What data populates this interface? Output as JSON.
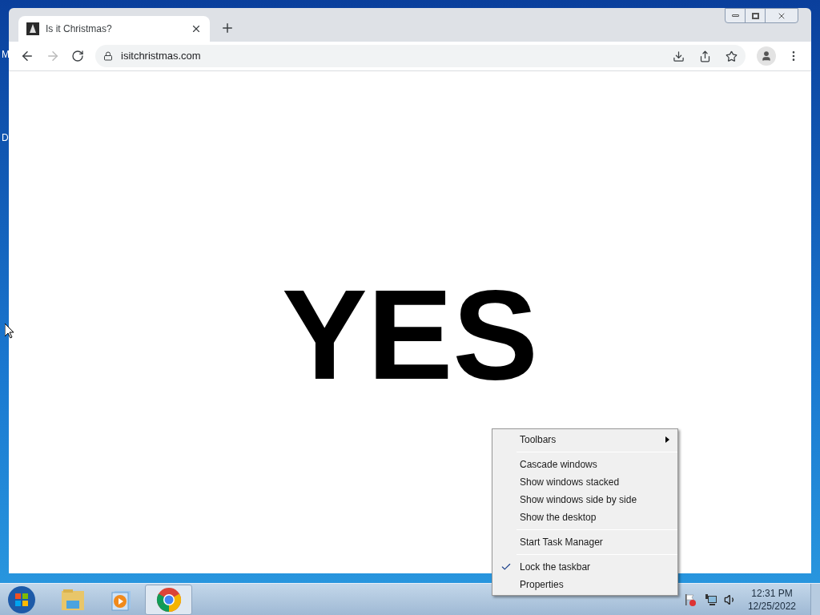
{
  "desktop_labels": [
    "M",
    "D"
  ],
  "browser": {
    "tab": {
      "title": "Is it Christmas?",
      "selected": true
    },
    "url": "isitchristmas.com",
    "back_disabled": false,
    "forward_disabled": true
  },
  "page": {
    "answer": "YES"
  },
  "context_menu": {
    "items": [
      {
        "kind": "submenu",
        "label": "Toolbars"
      },
      {
        "kind": "separator"
      },
      {
        "kind": "item",
        "label": "Cascade windows"
      },
      {
        "kind": "item",
        "label": "Show windows stacked"
      },
      {
        "kind": "item",
        "label": "Show windows side by side"
      },
      {
        "kind": "item",
        "label": "Show the desktop"
      },
      {
        "kind": "separator"
      },
      {
        "kind": "item",
        "label": "Start Task Manager"
      },
      {
        "kind": "separator"
      },
      {
        "kind": "check",
        "label": "Lock the taskbar",
        "checked": true
      },
      {
        "kind": "item",
        "label": "Properties"
      }
    ]
  },
  "taskbar": {
    "apps": [
      {
        "kind": "explorer",
        "selected": false
      },
      {
        "kind": "media",
        "selected": false
      },
      {
        "kind": "chrome",
        "selected": true
      }
    ],
    "time": "12:31 PM",
    "date": "12/25/2022"
  }
}
